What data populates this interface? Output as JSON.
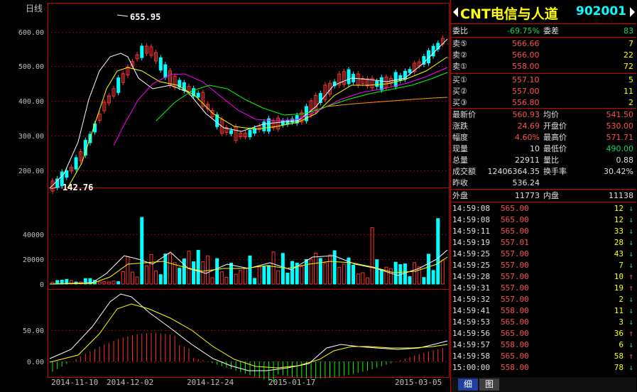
{
  "chart": {
    "period_label": "日线",
    "price_labels": [
      "600.00",
      "500.00",
      "400.00",
      "300.00",
      "200.00"
    ],
    "high_marker": "655.95",
    "low_marker": "142.76",
    "volume_labels": [
      "40000",
      "20000",
      "0"
    ],
    "macd_labels": [
      "50.00",
      "0.00"
    ],
    "date_labels": [
      "2014-11-10",
      "2014-12-02",
      "2014-12-24",
      "2015-01-17",
      "2015-03-05"
    ]
  },
  "panel": {
    "title": "CNT电信与人道",
    "code": "902001",
    "weibi_label": "委比",
    "weibi_value": "-69.75%",
    "weicha_label": "委差",
    "weicha_value": "83",
    "asks": [
      {
        "label": "卖⑤",
        "price": "566.66",
        "qty": "7"
      },
      {
        "label": "卖②",
        "price": "566.00",
        "qty": "22"
      },
      {
        "label": "卖①",
        "price": "558.00",
        "qty": "72"
      }
    ],
    "bids": [
      {
        "label": "买①",
        "price": "557.10",
        "qty": "5"
      },
      {
        "label": "买②",
        "price": "557.00",
        "qty": "11"
      },
      {
        "label": "买③",
        "price": "556.80",
        "qty": "2"
      }
    ],
    "stats": [
      {
        "l1": "最新价",
        "v1": "560.93",
        "c1": "red",
        "l2": "均价",
        "v2": "541.50",
        "c2": "red"
      },
      {
        "l1": "涨跌",
        "v1": "24.69",
        "c1": "red",
        "l2": "开盘价",
        "v2": "530.00",
        "c2": "red"
      },
      {
        "l1": "幅度",
        "v1": "4.60%",
        "c1": "red",
        "l2": "最高价",
        "v2": "571.71",
        "c2": "red"
      },
      {
        "l1": "现量",
        "v1": "10",
        "c1": "white",
        "l2": "最低价",
        "v2": "490.00",
        "c2": "green"
      },
      {
        "l1": "总量",
        "v1": "22911",
        "c1": "white",
        "l2": "量比",
        "v2": "0.88",
        "c2": "white"
      },
      {
        "l1": "成交额",
        "v1": "12406364.35",
        "c1": "white",
        "l2": "换手率",
        "v2": "30.42%",
        "c2": "white"
      }
    ],
    "prev_close_label": "昨收",
    "prev_close_value": "536.24",
    "outer_label": "外盘",
    "outer_value": "11773",
    "inner_label": "内盘",
    "inner_value": "11138",
    "ticks": [
      {
        "time": "14:59:08",
        "price": "565.00",
        "qty": "12",
        "dir": "down"
      },
      {
        "time": "14:59:08",
        "price": "565.00",
        "qty": "12",
        "dir": "down"
      },
      {
        "time": "14:59:11",
        "price": "565.00",
        "qty": "33",
        "dir": "down"
      },
      {
        "time": "14:59:19",
        "price": "557.01",
        "qty": "28",
        "dir": "down"
      },
      {
        "time": "14:59:25",
        "price": "557.00",
        "qty": "43",
        "dir": "down"
      },
      {
        "time": "14:59:25",
        "price": "557.00",
        "qty": "7",
        "dir": "down"
      },
      {
        "time": "14:59:28",
        "price": "557.00",
        "qty": "10",
        "dir": "up"
      },
      {
        "time": "14:59:31",
        "price": "557.00",
        "qty": "19",
        "dir": "up"
      },
      {
        "time": "14:59:32",
        "price": "557.00",
        "qty": "2",
        "dir": "down"
      },
      {
        "time": "14:59:41",
        "price": "558.00",
        "qty": "11",
        "dir": "down"
      },
      {
        "time": "14:59:53",
        "price": "565.00",
        "qty": "3",
        "dir": "down"
      },
      {
        "time": "14:59:56",
        "price": "565.00",
        "qty": "36",
        "dir": "up"
      },
      {
        "time": "14:59:57",
        "price": "558.00",
        "qty": "6",
        "dir": "down"
      },
      {
        "time": "14:59:58",
        "price": "565.00",
        "qty": "58",
        "dir": "up"
      },
      {
        "time": "15:00:00",
        "price": "558.00",
        "qty": "78",
        "dir": "down"
      }
    ],
    "bottom_tabs": [
      "细",
      "图"
    ]
  }
}
